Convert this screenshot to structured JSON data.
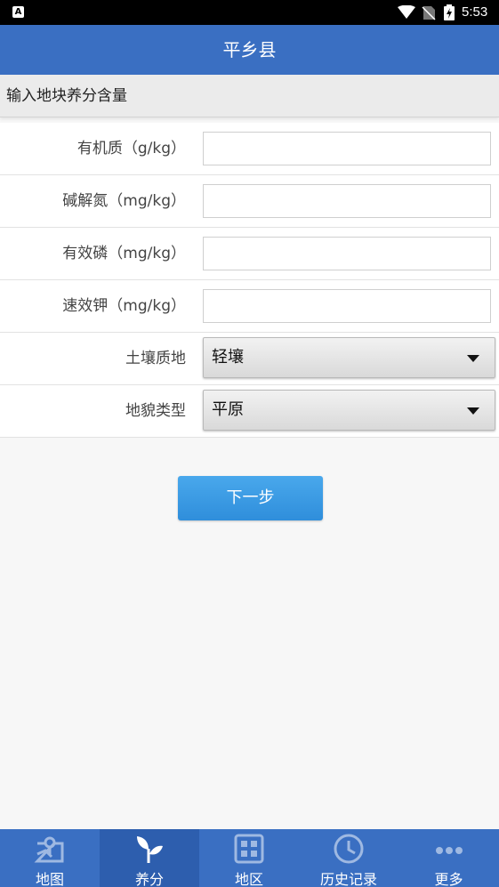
{
  "status_bar": {
    "time": "5:53",
    "left_icon": "A"
  },
  "title_bar": {
    "title": "平乡县"
  },
  "section": {
    "title": "输入地块养分含量"
  },
  "fields": [
    {
      "label": "有机质（g/kg）",
      "value": ""
    },
    {
      "label": "碱解氮（mg/kg）",
      "value": ""
    },
    {
      "label": "有效磷（mg/kg）",
      "value": ""
    },
    {
      "label": "速效钾（mg/kg）",
      "value": ""
    }
  ],
  "selects": [
    {
      "label": "土壤质地",
      "value": "轻壤"
    },
    {
      "label": "地貌类型",
      "value": "平原"
    }
  ],
  "next_button": {
    "label": "下一步"
  },
  "tabs": [
    {
      "label": "地图",
      "icon": "map-icon",
      "active": false
    },
    {
      "label": "养分",
      "icon": "sprout-icon",
      "active": true
    },
    {
      "label": "地区",
      "icon": "grid-icon",
      "active": false
    },
    {
      "label": "历史记录",
      "icon": "clock-icon",
      "active": false
    },
    {
      "label": "更多",
      "icon": "more-icon",
      "active": false
    }
  ],
  "colors": {
    "primary": "#3a6fc2",
    "active_tab": "#2d5eae",
    "button": "#3b9ae4"
  }
}
